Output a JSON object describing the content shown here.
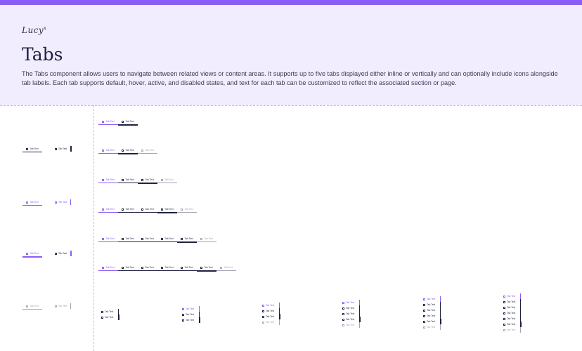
{
  "brand": {
    "logo_text": "Lucy",
    "logo_mark": "x"
  },
  "header": {
    "title": "Tabs",
    "description": "The Tabs component allows users to navigate between related views or content areas. It supports up to five tabs displayed either inline or vertically and can optionally include icons alongside tab labels. Each tab supports default, hover, active, and disabled states, and text for each tab can be customized to reflect the associated section or page."
  },
  "tab_label": "Tab Text",
  "colors": {
    "accent": "#8b5cf6",
    "header_bg": "#f1ecfe",
    "text": "#1f2140",
    "disabled": "#a4a4b4"
  }
}
